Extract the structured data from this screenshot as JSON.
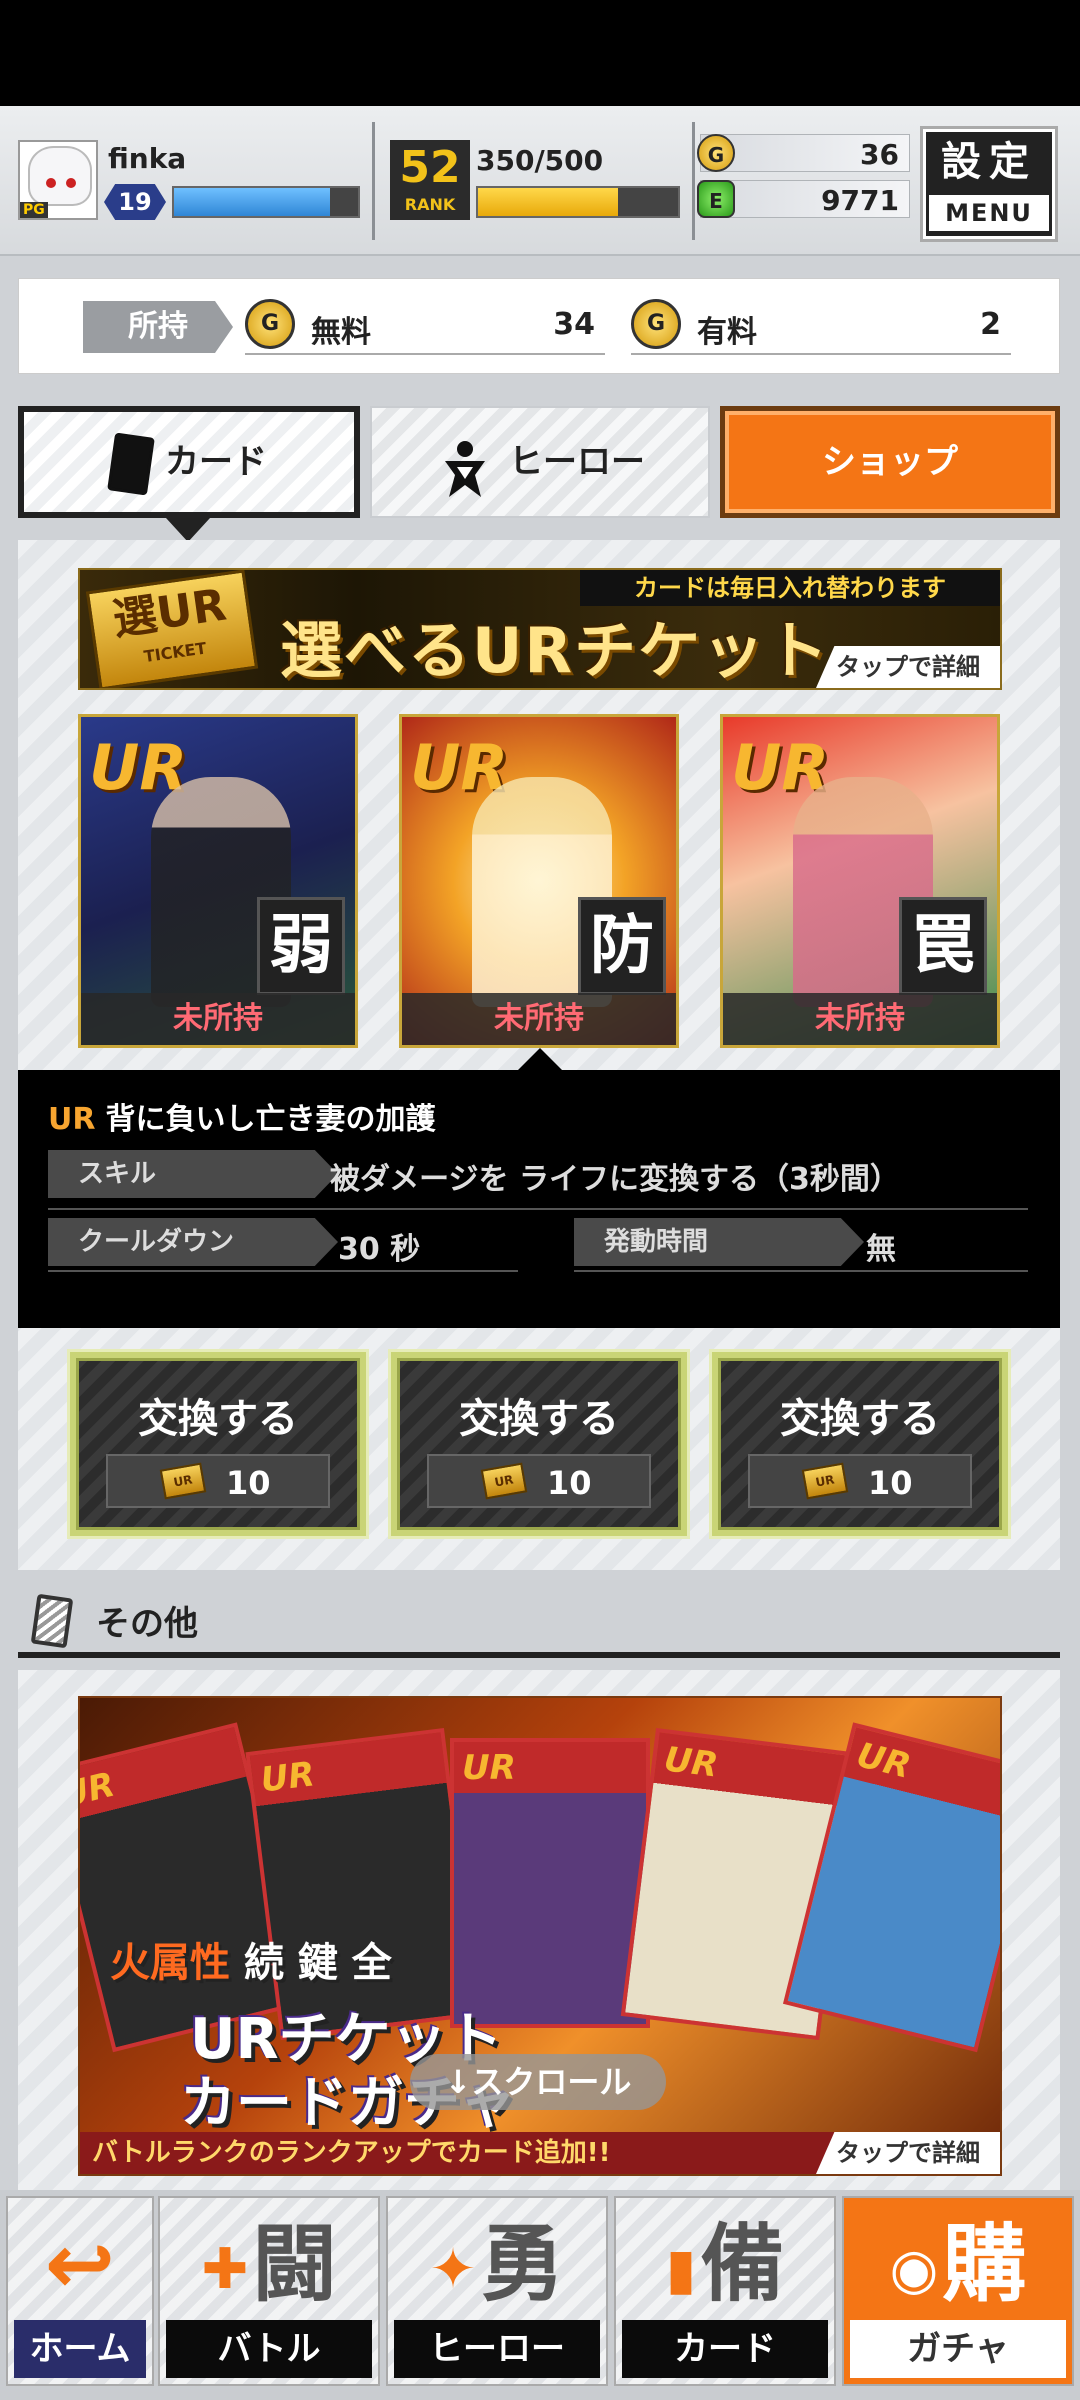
{
  "player": {
    "name": "finka",
    "level": "19",
    "avatar_tag": "PG",
    "xp_fraction": 0.85
  },
  "rank": {
    "number": "52",
    "label": "RANK",
    "stamina": "350/500",
    "stamina_fraction": 0.7
  },
  "currency": {
    "gold": "36",
    "green": "9771"
  },
  "menu_button": {
    "top": "設定",
    "bottom": "MENU"
  },
  "wallet": {
    "owned_label": "所持",
    "free_label": "無料",
    "free_value": "34",
    "paid_label": "有料",
    "paid_value": "2"
  },
  "tabs": [
    {
      "label": "カード"
    },
    {
      "label": "ヒーロー"
    },
    {
      "label": "ショップ"
    }
  ],
  "ur_banner": {
    "title": "選べるURチケット",
    "notice": "カードは毎日入れ替わります",
    "detail": "タップで詳細",
    "ticket_text": "選UR",
    "ticket_sub": "TICKET"
  },
  "cards": [
    {
      "rarity": "UR",
      "kanji": "弱",
      "status": "未所持"
    },
    {
      "rarity": "UR",
      "kanji": "防",
      "status": "未所持"
    },
    {
      "rarity": "UR",
      "kanji": "罠",
      "status": "未所持"
    }
  ],
  "skill": {
    "rarity": "UR",
    "name": "背に負いし亡き妻の加護",
    "skill_label": "スキル",
    "skill_value": "被ダメージを ライフに変換する（3秒間）",
    "cooldown_label": "クールダウン",
    "cooldown_value": "30 秒",
    "duration_label": "発動時間",
    "duration_value": "無"
  },
  "exchange": [
    {
      "label": "交換する",
      "cost": "10"
    },
    {
      "label": "交換する",
      "cost": "10"
    },
    {
      "label": "交換する",
      "cost": "10"
    }
  ],
  "other_section": {
    "title": "その他"
  },
  "gacha_banner": {
    "title_line1_fire": "火属性",
    "title_line1_rest": "続 鍵 全",
    "title_line2": "URチケット",
    "title_line3": "カードガチャ",
    "strip": "バトルランクのランクアップでカード追加!!",
    "detail": "タップで詳細",
    "scroll_hint": "↓スクロール"
  },
  "bottom_nav": [
    {
      "kanji": "↩",
      "label": "ホーム"
    },
    {
      "kanji": "闘",
      "label": "バトル"
    },
    {
      "kanji": "勇",
      "label": "ヒーロー"
    },
    {
      "kanji": "備",
      "label": "カード"
    },
    {
      "kanji": "購",
      "label": "ガチャ"
    }
  ],
  "colors": {
    "accent": "#f47515",
    "xp": "#2f86d6",
    "stamina": "#e8a90a",
    "unowned": "#ff6a74"
  }
}
